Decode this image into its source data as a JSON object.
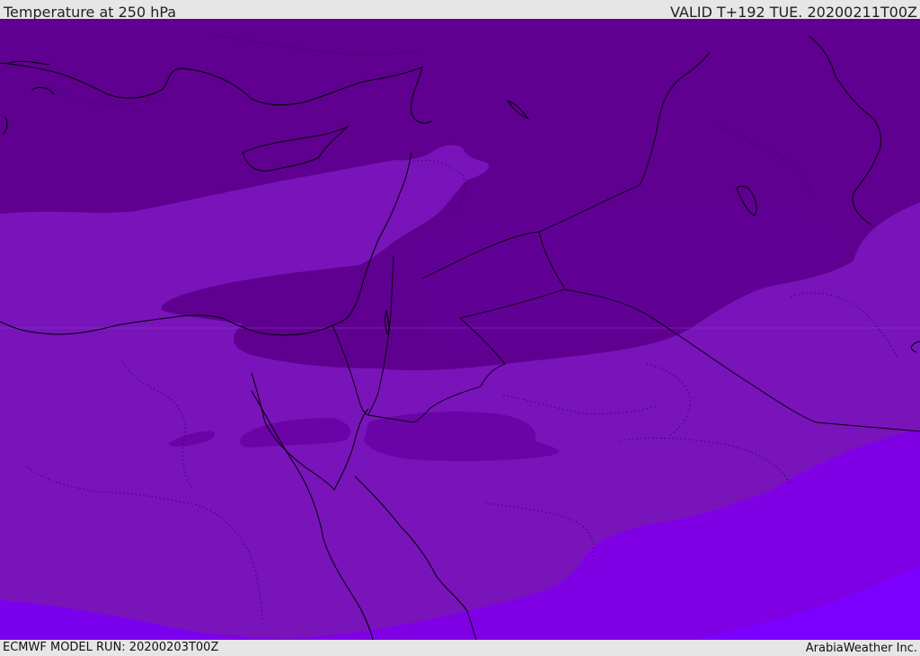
{
  "header": {
    "title": "Temperature at 250 hPa",
    "valid": "VALID T+192 TUE. 20200211T00Z"
  },
  "footer": {
    "model_run": "ECMWF MODEL RUN: 20200203T00Z",
    "credit": "ArabiaWeather Inc."
  },
  "colors": {
    "coldest_band": "#5f0090",
    "cold_band": "#6e10ad",
    "mid_band": "#7814b9",
    "warm_band": "#8000e6",
    "warmest_band": "#7c00ff",
    "coastline": "#000000",
    "border": "#000000"
  }
}
